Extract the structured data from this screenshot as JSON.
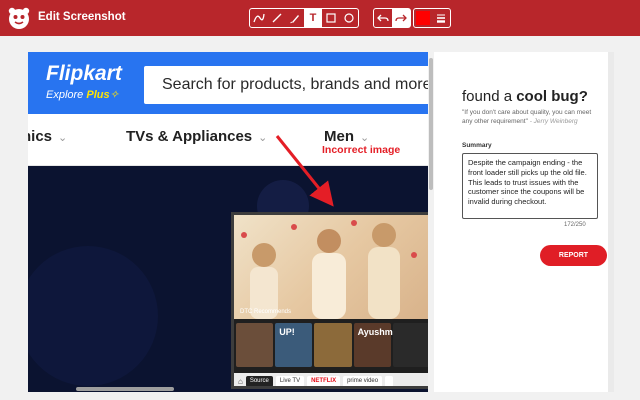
{
  "app": {
    "title": "Edit Screenshot",
    "accent_color": "#b8262b"
  },
  "toolbar": {
    "draw_tools": [
      {
        "name": "curve-tool",
        "icon": "curve-line-icon"
      },
      {
        "name": "line-tool",
        "icon": "straight-line-icon"
      },
      {
        "name": "pen-tool",
        "icon": "pen-icon"
      },
      {
        "name": "text-tool",
        "label": "T",
        "active": true
      },
      {
        "name": "rectangle-tool",
        "icon": "rectangle-icon"
      },
      {
        "name": "ellipse-tool",
        "icon": "circle-icon"
      }
    ],
    "history": [
      {
        "name": "undo-button",
        "icon": "undo-icon"
      },
      {
        "name": "redo-button",
        "icon": "redo-icon"
      }
    ],
    "color": "#ff0000",
    "stroke_icon": "line-weight-icon"
  },
  "screenshot": {
    "brand": "Flipkart",
    "brand_sub_prefix": "Explore ",
    "brand_sub_plus": "Plus",
    "search_placeholder": "Search for products, brands and more",
    "nav_items": [
      "nics",
      "TVs & Appliances",
      "Men"
    ],
    "annotation_text": "Incorrect image",
    "annotation_color": "#e41e26",
    "tv_caption": "DTC Recommends",
    "tiles": [
      {
        "label": "",
        "color": "#6b4e3a"
      },
      {
        "label": "UP!",
        "color": "#3b5b7a"
      },
      {
        "label": "",
        "color": "#8c6a3a"
      },
      {
        "label": "Ayushmann",
        "color": "#5a3a2a"
      },
      {
        "label": "",
        "color": "#2a2a2a"
      }
    ],
    "bar_chips": [
      {
        "label": "Source",
        "style": "dark"
      },
      {
        "label": "Live TV",
        "style": "plain"
      },
      {
        "label": "NETFLIX",
        "style": "red"
      },
      {
        "label": "prime video",
        "style": "plain"
      },
      {
        "label": "",
        "style": "plain"
      }
    ]
  },
  "panel": {
    "title_prefix": "found a ",
    "title_bold": "cool bug?",
    "quote": "\"If you don't care about quality, you can meet any other requirement\"",
    "quote_author": " - Jerry Weinberg",
    "summary_label": "Summary",
    "summary_text": "Despite the campaign ending - the front loader still picks up the old file. This leads to trust issues with the customer since the coupons will be invalid during checkout.",
    "counter": "172/250",
    "report_label": "REPORT"
  }
}
